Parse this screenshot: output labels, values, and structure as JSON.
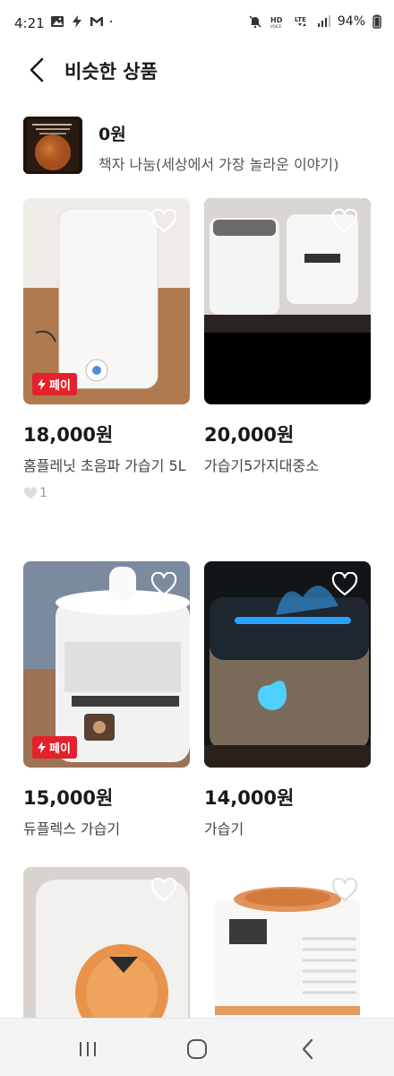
{
  "status_bar": {
    "time": "4:21",
    "battery": "94%",
    "left_icons": [
      "gallery-icon",
      "bolt-icon",
      "gmail-icon",
      "dot-icon"
    ],
    "right_icons": [
      "mute-icon",
      "hd-voice-icon",
      "lte-icon",
      "signal-icon"
    ]
  },
  "header": {
    "title": "비슷한 상품"
  },
  "featured": {
    "price": "0원",
    "name": "책자 나눔(세상에서 가장 놀라운 이야기)"
  },
  "products": [
    {
      "price": "18,000원",
      "name": "홈플레닛 초음파 가습기 5L",
      "pay_badge": "페이",
      "likes": "1"
    },
    {
      "price": "20,000원",
      "name": "가습기5가지대중소"
    },
    {
      "price": "15,000원",
      "name": "듀플렉스 가습기",
      "pay_badge": "페이"
    },
    {
      "price": "14,000원",
      "name": "가습기"
    },
    {
      "price": "",
      "name": ""
    },
    {
      "price": "",
      "name": ""
    }
  ],
  "colors": {
    "accent_red": "#e3222b",
    "heart_outline": "#ffffff"
  }
}
